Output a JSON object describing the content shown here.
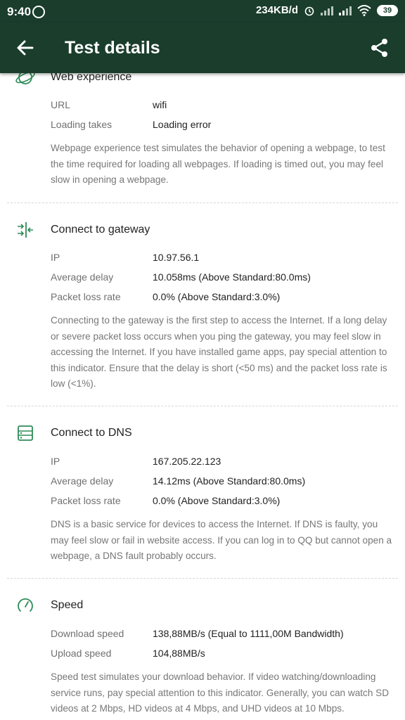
{
  "status_bar": {
    "time": "9:40",
    "net_speed": "234KB/d",
    "battery": "39"
  },
  "toolbar": {
    "title": "Test details"
  },
  "web": {
    "title": "Web experience",
    "rows": [
      {
        "label": "URL",
        "value": "wifi"
      },
      {
        "label": "Loading takes",
        "value": "Loading error"
      }
    ],
    "description": "Webpage experience test simulates the behavior of opening a webpage, to test the time required for loading all webpages. If loading is timed out, you may feel slow in opening a webpage."
  },
  "gateway": {
    "title": "Connect to gateway",
    "rows": [
      {
        "label": "IP",
        "value": "10.97.56.1"
      },
      {
        "label": "Average delay",
        "value": "10.058ms (Above Standard:80.0ms)"
      },
      {
        "label": "Packet loss rate",
        "value": "0.0% (Above Standard:3.0%)"
      }
    ],
    "description": "Connecting to the gateway is the first step to access the Internet. If a long delay or severe packet loss occurs when you ping the gateway, you may feel slow in accessing the Internet. If you have installed game apps, pay special attention to this indicator. Ensure that the delay is short (<50 ms) and the packet loss rate is low (<1%)."
  },
  "dns": {
    "title": "Connect to DNS",
    "rows": [
      {
        "label": "IP",
        "value": "167.205.22.123"
      },
      {
        "label": "Average delay",
        "value": "14.12ms (Above Standard:80.0ms)"
      },
      {
        "label": "Packet loss rate",
        "value": "0.0% (Above Standard:3.0%)"
      }
    ],
    "description": "DNS is a basic service for devices to access the Internet. If DNS is faulty, you may feel slow or fail in website access. If you can log in to QQ but cannot open a webpage, a DNS fault probably occurs."
  },
  "speed": {
    "title": "Speed",
    "rows": [
      {
        "label": "Download speed",
        "value": "138,88MB/s (Equal to 1111,00M Bandwidth)"
      },
      {
        "label": "Upload speed",
        "value": "104,88MB/s"
      }
    ],
    "description": "Speed test simulates your download behavior. If video watching/downloading service runs, pay special attention to this indicator. Generally, you can watch SD videos at 2 Mbps, HD videos at 4 Mbps, and UHD videos at 10 Mbps."
  },
  "colors": {
    "toolbar": "#1a3d2c",
    "accent": "#2e8b57"
  }
}
